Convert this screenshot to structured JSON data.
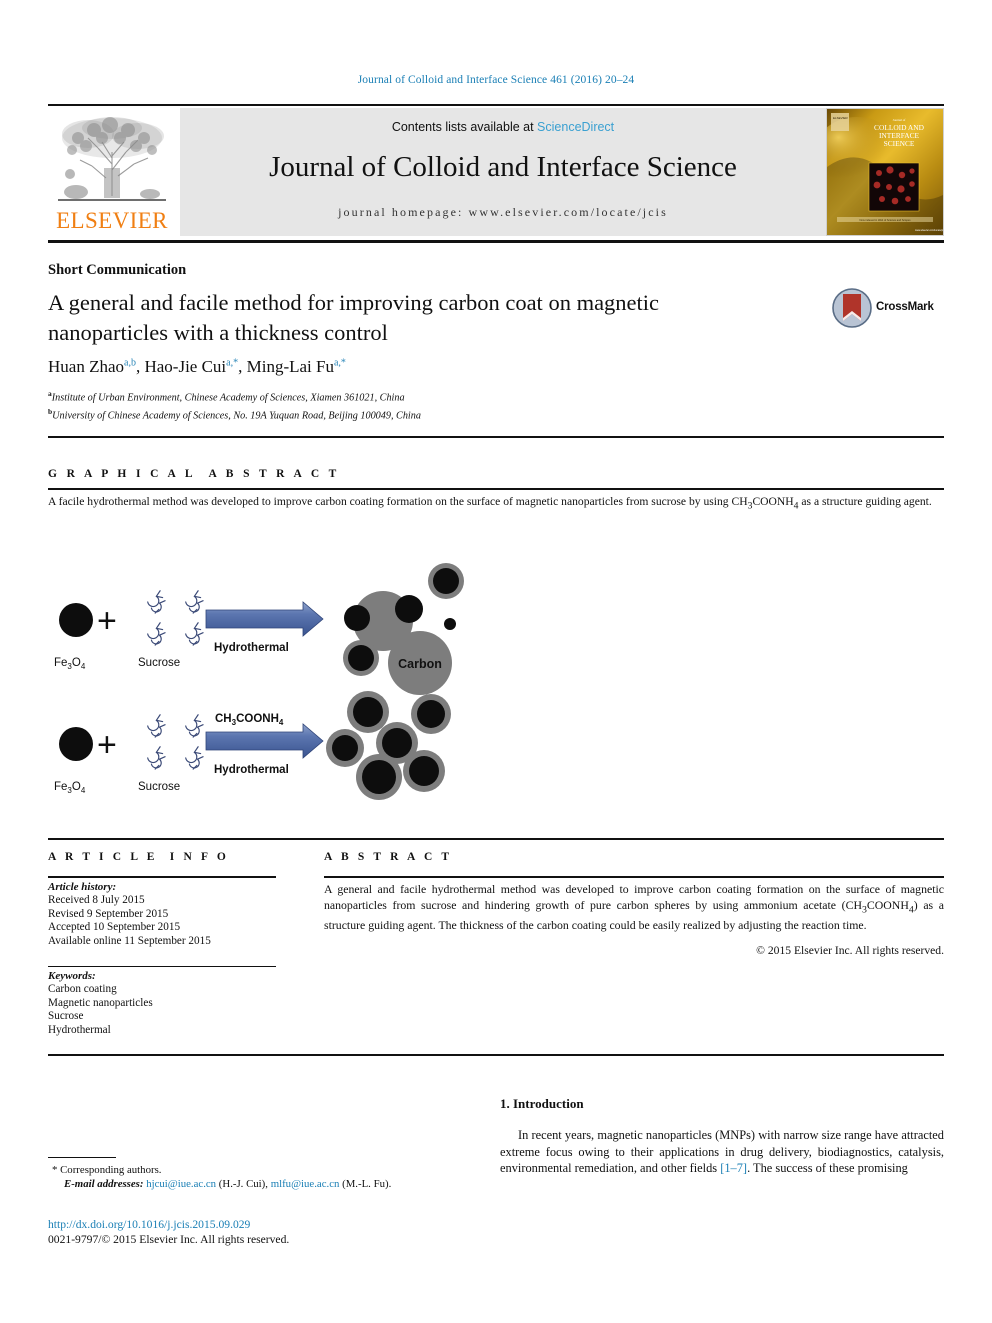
{
  "running_head": "Journal of Colloid and Interface Science 461 (2016) 20–24",
  "masthead": {
    "publisher": "ELSEVIER",
    "contents_prefix": "Contents lists available at ",
    "contents_link": "ScienceDirect",
    "journal_name": "Journal of Colloid and Interface Science",
    "homepage": "journal homepage: www.elsevier.com/locate/jcis",
    "cover_line1": "Journal of",
    "cover_line2": "COLLOID AND",
    "cover_line3": "INTERFACE",
    "cover_line4": "SCIENCE"
  },
  "article": {
    "type": "Short Communication",
    "title": "A general and facile method for improving carbon coat on magnetic nanoparticles with a thickness control",
    "crossmark_label": "CrossMark",
    "authors": [
      {
        "name": "Huan Zhao",
        "sup": "a,b",
        "sep": ", "
      },
      {
        "name": "Hao-Jie Cui",
        "sup": "a,*",
        "sep": ", "
      },
      {
        "name": "Ming-Lai Fu",
        "sup": "a,*",
        "sep": ""
      }
    ],
    "affiliations": [
      {
        "mark": "a",
        "text": "Institute of Urban Environment, Chinese Academy of Sciences, Xiamen 361021, China"
      },
      {
        "mark": "b",
        "text": "University of Chinese Academy of Sciences, No. 19A Yuquan Road, Beijing 100049, China"
      }
    ]
  },
  "graphical_abstract": {
    "heading": "GRAPHICAL ABSTRACT",
    "text": "A facile hydrothermal method was developed to improve carbon coating formation on the surface of magnetic nanoparticles from sucrose by using CH3COONH4 as a structure guiding agent.",
    "figure": {
      "row1": {
        "reactant_label": "Fe3O4",
        "additive_label": "Sucrose",
        "plus": "+",
        "arrow_label_bottom": "Hydrothermal",
        "arrow_label_top": "",
        "product_label": "Carbon"
      },
      "row2": {
        "reactant_label": "Fe3O4",
        "additive_label": "Sucrose",
        "plus": "+",
        "arrow_label_top": "CH3COONH4",
        "arrow_label_bottom": "Hydrothermal"
      },
      "colors": {
        "particle_core": "#0d0d0d",
        "carbon_shell": "#7d7d7d",
        "arrow": "#4a68a8",
        "sucrose": "#3b4a77"
      }
    }
  },
  "article_info": {
    "heading": "ARTICLE INFO",
    "history_label": "Article history:",
    "history": [
      "Received 8 July 2015",
      "Revised 9 September 2015",
      "Accepted 10 September 2015",
      "Available online 11 September 2015"
    ],
    "keywords_label": "Keywords:",
    "keywords": [
      "Carbon coating",
      "Magnetic nanoparticles",
      "Sucrose",
      "Hydrothermal"
    ]
  },
  "abstract": {
    "heading": "ABSTRACT",
    "text": "A general and facile hydrothermal method was developed to improve carbon coating formation on the surface of magnetic nanoparticles from sucrose and hindering growth of pure carbon spheres by using ammonium acetate (CH3COONH4) as a structure guiding agent. The thickness of the carbon coating could be easily realized by adjusting the reaction time.",
    "copyright": "© 2015 Elsevier Inc. All rights reserved."
  },
  "body": {
    "section_number_title": "1. Introduction",
    "paragraph_part1": "In recent years, magnetic nanoparticles (MNPs) with narrow size range have attracted extreme focus owing to their applications in drug delivery, biodiagnostics, catalysis, environmental remediation, and other fields ",
    "reference": "[1–7]",
    "paragraph_part2": ". The success of these promising"
  },
  "footer": {
    "corresponding_mark": "*",
    "corresponding_label": "Corresponding authors.",
    "email_label": "E-mail addresses:",
    "email1": "hjcui@iue.ac.cn",
    "email1_owner": "(H.-J. Cui)",
    "email2": "mlfu@iue.ac.cn",
    "email2_owner": "(M.-L. Fu).",
    "doi": "http://dx.doi.org/10.1016/j.jcis.2015.09.029",
    "issn": "0021-9797/© 2015 Elsevier Inc. All rights reserved."
  },
  "colors": {
    "link_blue": "#1a7fb5",
    "sciencedirect_blue": "#3aa0d1",
    "elsevier_orange": "#f07f13",
    "banner_gray": "#e6e6e6"
  }
}
